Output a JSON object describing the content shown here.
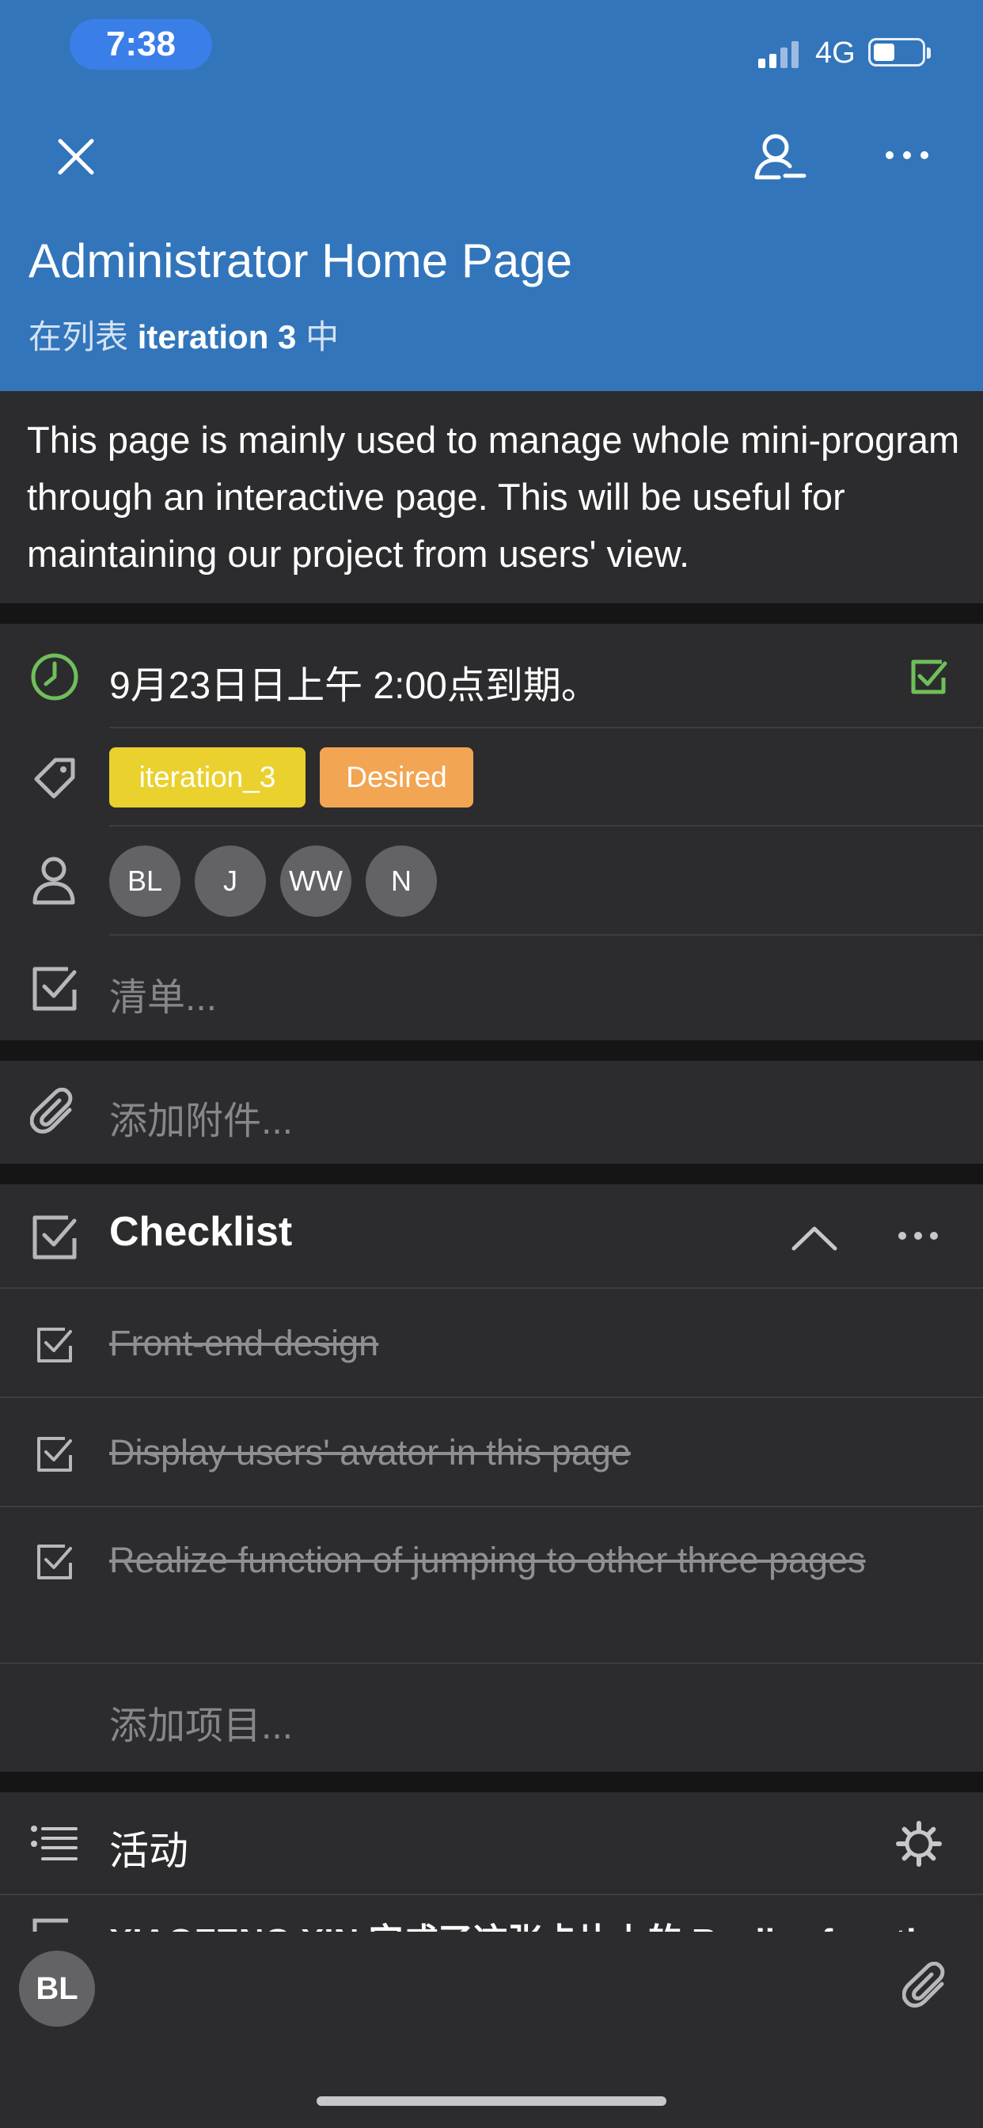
{
  "status_bar": {
    "time": "7:38",
    "network": "4G"
  },
  "header": {
    "title": "Administrator Home Page",
    "list_prefix": "在列表",
    "list_name": "iteration 3",
    "list_suffix": "中",
    "background": "#3275bb"
  },
  "description": "This page is mainly used to manage whole mini-program through an interactive page. This will be useful for maintaining our project from users' view.",
  "due": {
    "text": "9月23日日上午 2:00点到期。",
    "completed": true,
    "accent": "#6fbf5a"
  },
  "labels": [
    {
      "text": "iteration_3",
      "color": "#ead12e"
    },
    {
      "text": "Desired",
      "color": "#f2a553"
    }
  ],
  "members": [
    "BL",
    "J",
    "WW",
    "N"
  ],
  "checklist_placeholder": "清单...",
  "attachment_placeholder": "添加附件...",
  "checklist": {
    "title": "Checklist",
    "items": [
      {
        "text": "Front-end design",
        "done": true
      },
      {
        "text": "Display users' avator in this page",
        "done": true
      },
      {
        "text": "Realize function of jumping to other three pages",
        "done": true
      }
    ],
    "add_item": "添加项目..."
  },
  "activity": {
    "title": "活动",
    "peek": "XIAOFENG XIN 完成了这张卡片上的 Realize function"
  },
  "composer": {
    "avatar": "BL"
  }
}
